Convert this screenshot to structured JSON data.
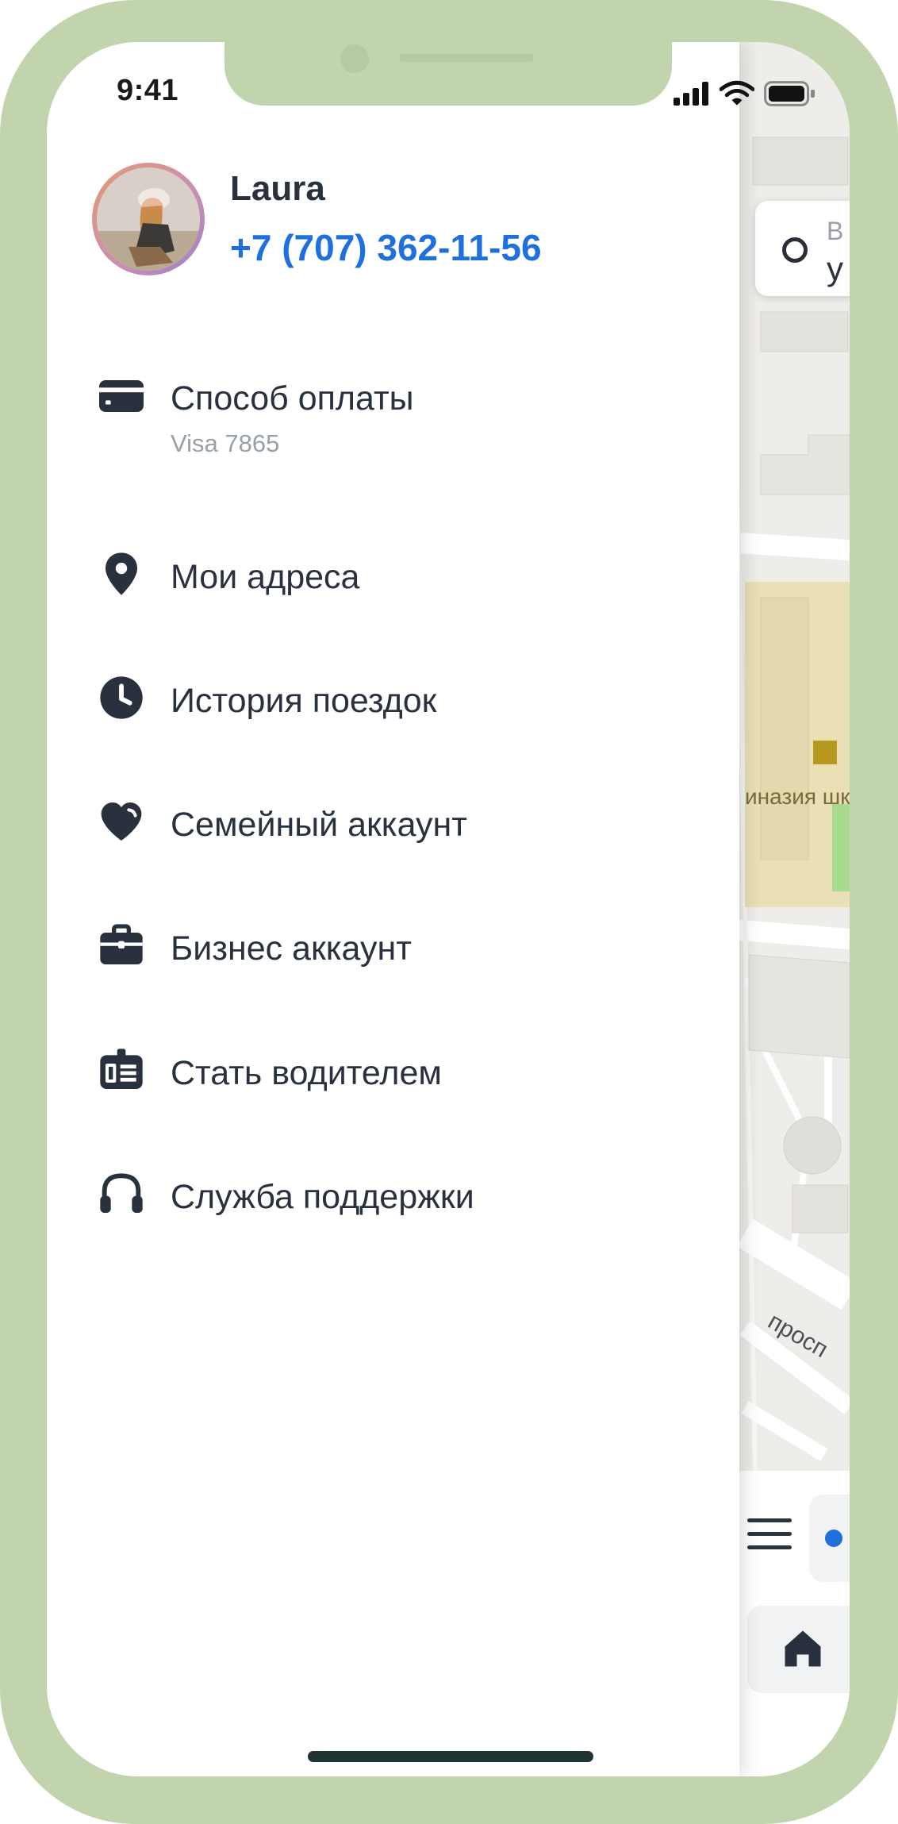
{
  "status_bar": {
    "time": "9:41"
  },
  "profile": {
    "name": "Laura",
    "phone": "+7 (707) 362-11-56"
  },
  "menu": [
    {
      "label": "Способ оплаты",
      "sublabel": "Visa 7865",
      "icon": "credit-card-icon"
    },
    {
      "label": "Мои адреса",
      "icon": "location-pin-icon"
    },
    {
      "label": "История поездок",
      "icon": "clock-icon"
    },
    {
      "label": "Семейный аккаунт",
      "icon": "heart-icon"
    },
    {
      "label": "Бизнес аккаунт",
      "icon": "briefcase-icon"
    },
    {
      "label": "Стать водителем",
      "icon": "driver-badge-icon"
    },
    {
      "label": "Служба поддержки",
      "icon": "headset-icon"
    }
  ],
  "map": {
    "search_card": {
      "line1": "В",
      "line2": "у"
    },
    "poi_label": "иназия шк",
    "street_label": "просп"
  },
  "colors": {
    "frame": "#c2d4ae",
    "accent": "#1f6fdc",
    "text": "#28313d",
    "muted": "#98a0a8"
  }
}
